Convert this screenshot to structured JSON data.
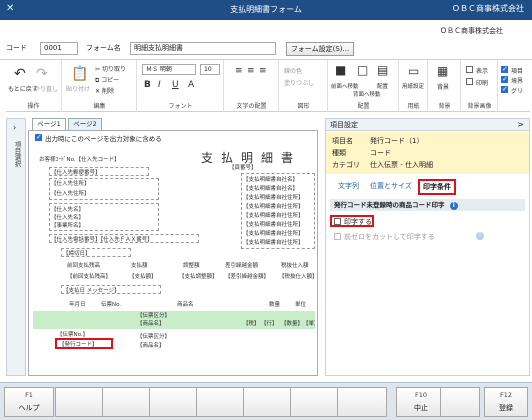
{
  "window": {
    "title": "支払明細書フォーム",
    "company": "ＯＢＣ商事株式会社",
    "close_glyph": "✕"
  },
  "header": {
    "code_label": "コード",
    "code_value": "0001",
    "form_name_label": "フォーム名",
    "form_name_value": "明細支払明細書",
    "form_settings_button": "フォーム設定(S)..."
  },
  "ribbon": {
    "groups": [
      {
        "name": "操作",
        "items": [
          "もとに戻す",
          "やり直し"
        ]
      },
      {
        "name": "編集",
        "items": [
          "貼り付け",
          "切り取り",
          "コピー",
          "削除"
        ]
      },
      {
        "name": "フォント",
        "font_name": "ＭＳ 明朝",
        "font_size": "10",
        "styles": [
          "B",
          "I",
          "U",
          "A"
        ]
      },
      {
        "name": "文字の配置",
        "items": []
      },
      {
        "name": "図形",
        "items": [
          "線の色",
          "塗りつぶし"
        ]
      },
      {
        "name": "配置",
        "items": [
          "前面へ移動",
          "背面へ移動",
          "配置"
        ]
      },
      {
        "name": "用紙",
        "items": [
          "用紙設定"
        ]
      },
      {
        "name": "背景",
        "items": [
          "背景"
        ]
      },
      {
        "name": "背景画像",
        "items": [
          "表示",
          "印刷"
        ]
      },
      {
        "name": "",
        "items": [
          "項目",
          "境界",
          "グリ"
        ]
      }
    ]
  },
  "left_strip": {
    "label": "項目選択"
  },
  "editor": {
    "tabs": [
      "ページ1",
      "ページ2"
    ],
    "print_all_label": "出力時にこのページを出力対象に含める",
    "doc_title": "支払明細書",
    "doc_texts": {
      "customer_code": "お客様ｺｰﾄﾞNo.【仕入先コード】",
      "page_number": "【頁番号】",
      "supplier_zip": "【仕入先郵便番号】",
      "supplier_addr1": "【仕入先住所】",
      "supplier_addr2": "【仕入先住所】",
      "supplier_name1": "【仕入先名】",
      "supplier_name2": "【仕入先名】",
      "dept": "【事業所名】",
      "tel_fax": "【仕入先電話番号】【仕入先ＦＡＸ番号】",
      "right_column": [
        "【支払明細書自社名】",
        "【支払明細書自社名】",
        "【支払明細書自社住所】",
        "【支払明細書自社住所】",
        "【支払明細書自社住所】",
        "【支払明細書自社住所】",
        "【支払明細書自社住所】",
        "【支払明細書自社住所】"
      ],
      "closing_date": "【締切日】",
      "summary_headers": [
        "前回支払残高",
        "支払額",
        "調整額",
        "差引繰越金額",
        "税抜仕入額"
      ],
      "summary_values": [
        "【前回支払残高】",
        "【支払額】",
        "【支払調整額】",
        "【差引繰越金額】",
        "【税抜仕入額】"
      ],
      "message": "【支払日 メッセージ】",
      "detail_headers": [
        "年月日",
        "伝票No.",
        "商品名",
        "数量",
        "単位"
      ],
      "detail_row1": [
        "【伝票区分】",
        "【商品名】"
      ],
      "detail_row2": [
        "【伝票No.】"
      ],
      "highlighted_field": "【発行コード】",
      "detail_row3": [
        "【伝票区分】",
        "【商品名】"
      ],
      "small_brackets": [
        "【税】",
        "【行】",
        "【数量】",
        "【単】"
      ]
    }
  },
  "props": {
    "header": "項目設定",
    "collapse_glyph": ">",
    "info": [
      {
        "label": "項目名",
        "value": "発行コード（1）"
      },
      {
        "label": "種類",
        "value": "コード"
      },
      {
        "label": "カテゴリ",
        "value": "仕入伝票 - 仕入明細"
      }
    ],
    "tabs": [
      "文字列",
      "位置とサイズ",
      "印字条件"
    ],
    "section_title": "発行コード未登録時の商品コード印字",
    "print_option_label": "印字する",
    "cut_zero_label": "前ゼロをカットして印字する"
  },
  "fkeys": [
    {
      "key": "F1",
      "label": "ヘルプ"
    },
    {
      "key": "",
      "label": ""
    },
    {
      "key": "",
      "label": ""
    },
    {
      "key": "",
      "label": ""
    },
    {
      "key": "",
      "label": ""
    },
    {
      "key": "",
      "label": ""
    },
    {
      "key": "",
      "label": ""
    },
    {
      "key": "",
      "label": ""
    },
    {
      "key": "F10",
      "label": "中止"
    },
    {
      "key": "",
      "label": ""
    },
    {
      "key": "F12",
      "label": "登録"
    }
  ],
  "colors": {
    "titlebar": "#1f4e87",
    "highlight_red": "#e0101a",
    "info_bg": "#fff6c8",
    "green_row": "#c9ecc9"
  }
}
